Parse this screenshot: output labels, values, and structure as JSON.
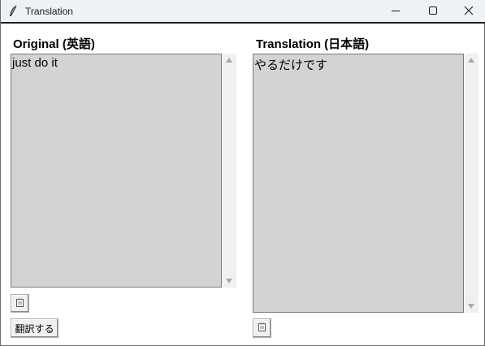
{
  "window": {
    "title": "Translation"
  },
  "icons": {
    "app": "feather-icon",
    "minimize": "minimize-icon",
    "maximize": "maximize-icon",
    "close": "close-icon",
    "copy": "clipboard-icon"
  },
  "original": {
    "label": "Original (英語)",
    "text": "just do it"
  },
  "translation": {
    "label": "Translation (日本語)",
    "text": "やるだけです"
  },
  "buttons": {
    "translate_label": "翻訳する"
  },
  "colors": {
    "textbox_bg": "#d3d3d3",
    "titlebar_bg": "#eef2f7",
    "button_bg": "#f0f0f0"
  }
}
